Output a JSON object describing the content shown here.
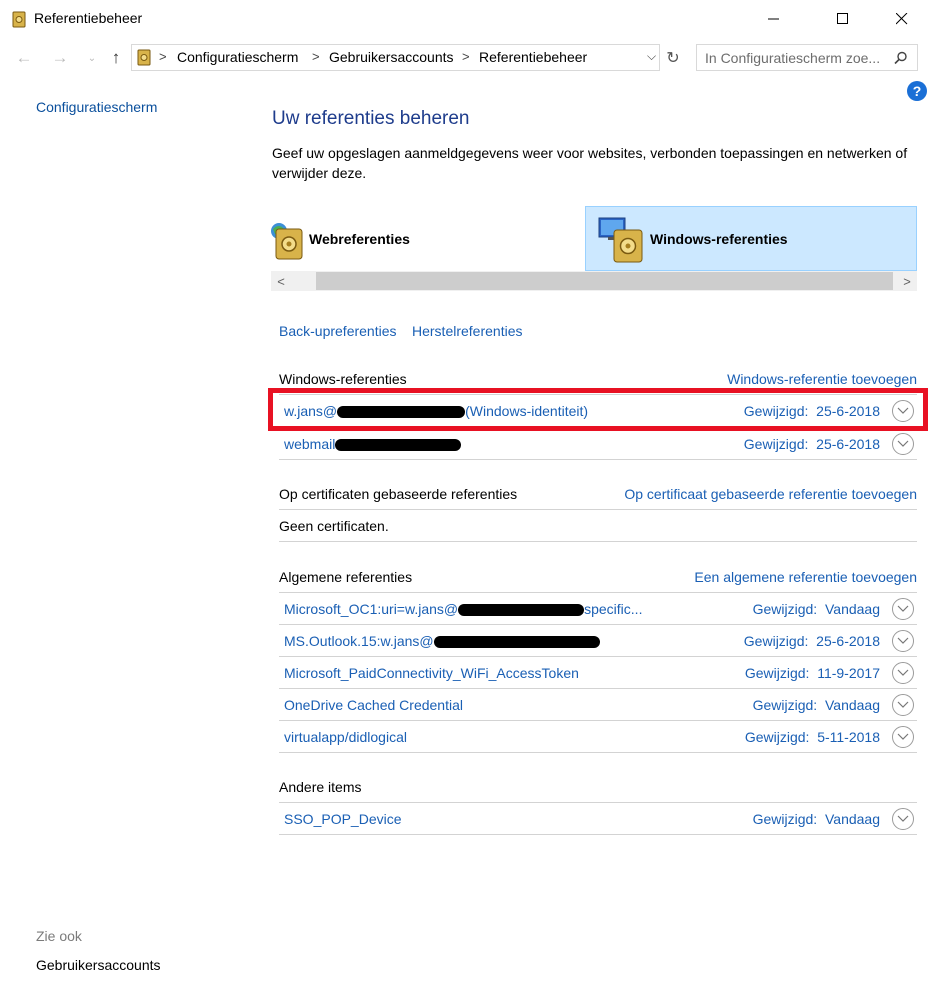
{
  "window": {
    "title": "Referentiebeheer"
  },
  "address": {
    "crumbs": [
      "Configuratiescherm",
      "Gebruikersaccounts",
      "Referentiebeheer"
    ],
    "search_placeholder": "In Configuratiescherm zoe..."
  },
  "sidebar": {
    "top_link": "Configuratiescherm",
    "see_also": "Zie ook",
    "bottom_link": "Gebruikersaccounts"
  },
  "main": {
    "heading": "Uw referenties beheren",
    "description": "Geef uw opgeslagen aanmeldgegevens weer voor websites, verbonden toepassingen en netwerken of verwijder deze.",
    "tabs": [
      {
        "label": "Webreferenties",
        "selected": false
      },
      {
        "label": "Windows-referenties",
        "selected": true
      }
    ],
    "actions": {
      "backup": "Back-upreferenties",
      "restore": "Herstelreferenties"
    }
  },
  "windows_section": {
    "title": "Windows-referenties",
    "add_link": "Windows-referentie toevoegen",
    "rows": [
      {
        "name_prefix": "w.jans@",
        "name_suffix": "(Windows-identiteit)",
        "modified_label": "Gewijzigd:",
        "modified": "25-6-2018"
      },
      {
        "name_prefix": "webmail",
        "name_suffix": "",
        "modified_label": "Gewijzigd:",
        "modified": "25-6-2018"
      }
    ]
  },
  "cert_section": {
    "title": "Op certificaten gebaseerde referenties",
    "add_link": "Op certificaat gebaseerde referentie toevoegen",
    "empty": "Geen certificaten."
  },
  "generic_section": {
    "title": "Algemene referenties",
    "add_link": "Een algemene referentie toevoegen",
    "rows": [
      {
        "name_prefix": "Microsoft_OC1:uri=w.jans@",
        "name_suffix": "specific...",
        "modified_label": "Gewijzigd:",
        "modified": "Vandaag"
      },
      {
        "name_prefix": "MS.Outlook.15:w.jans@",
        "name_suffix": "",
        "modified_label": "Gewijzigd:",
        "modified": "25-6-2018"
      },
      {
        "name_prefix": "Microsoft_PaidConnectivity_WiFi_AccessToken",
        "name_suffix": "",
        "modified_label": "Gewijzigd:",
        "modified": "11-9-2017"
      },
      {
        "name_prefix": "OneDrive Cached Credential",
        "name_suffix": "",
        "modified_label": "Gewijzigd:",
        "modified": "Vandaag"
      },
      {
        "name_prefix": "virtualapp/didlogical",
        "name_suffix": "",
        "modified_label": "Gewijzigd:",
        "modified": "5-11-2018"
      }
    ]
  },
  "other_section": {
    "title": "Andere items",
    "rows": [
      {
        "name_prefix": "SSO_POP_Device",
        "name_suffix": "",
        "modified_label": "Gewijzigd:",
        "modified": "Vandaag"
      }
    ]
  },
  "colors": {
    "link": "#1a5fb4",
    "heading": "#1e3c8c",
    "tab_selected": "#cce8ff",
    "highlight": "#e81123"
  }
}
